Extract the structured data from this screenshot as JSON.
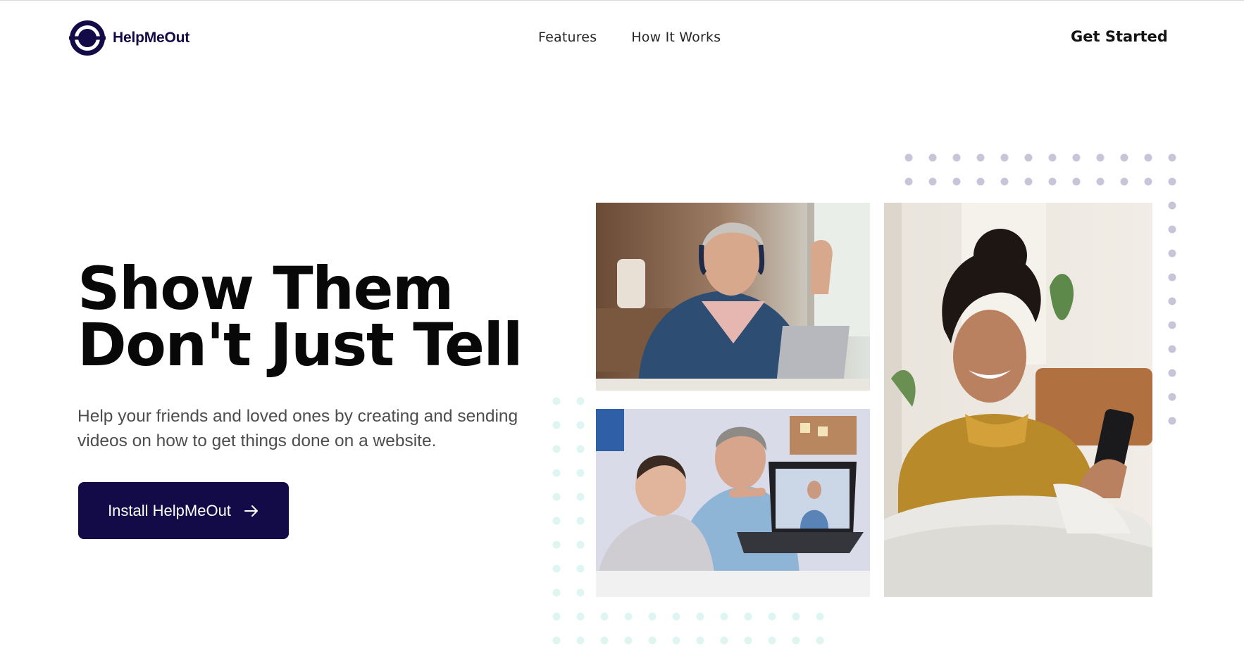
{
  "brand": {
    "name": "HelpMeOut",
    "icon": "helpmeout-logo-icon",
    "color": "#120b48"
  },
  "nav": {
    "items": [
      {
        "label": "Features"
      },
      {
        "label": "How It Works"
      }
    ],
    "cta_label": "Get Started"
  },
  "hero": {
    "title_line1": "Show Them",
    "title_line2": "Don't Just Tell",
    "subtitle": "Help your friends and loved ones by creating and sending videos on how to get things done on a website.",
    "button_label": "Install HelpMeOut",
    "button_icon": "arrow-right-icon",
    "button_color": "#120b48"
  },
  "gallery": {
    "dot_colors": {
      "purple": "#c9c5d9",
      "teal": "#dff5f1"
    },
    "images": [
      {
        "icon": "woman-headphones-laptop-photo"
      },
      {
        "icon": "boy-and-grandfather-video-call-photo"
      },
      {
        "icon": "woman-smiling-phone-photo"
      }
    ]
  }
}
